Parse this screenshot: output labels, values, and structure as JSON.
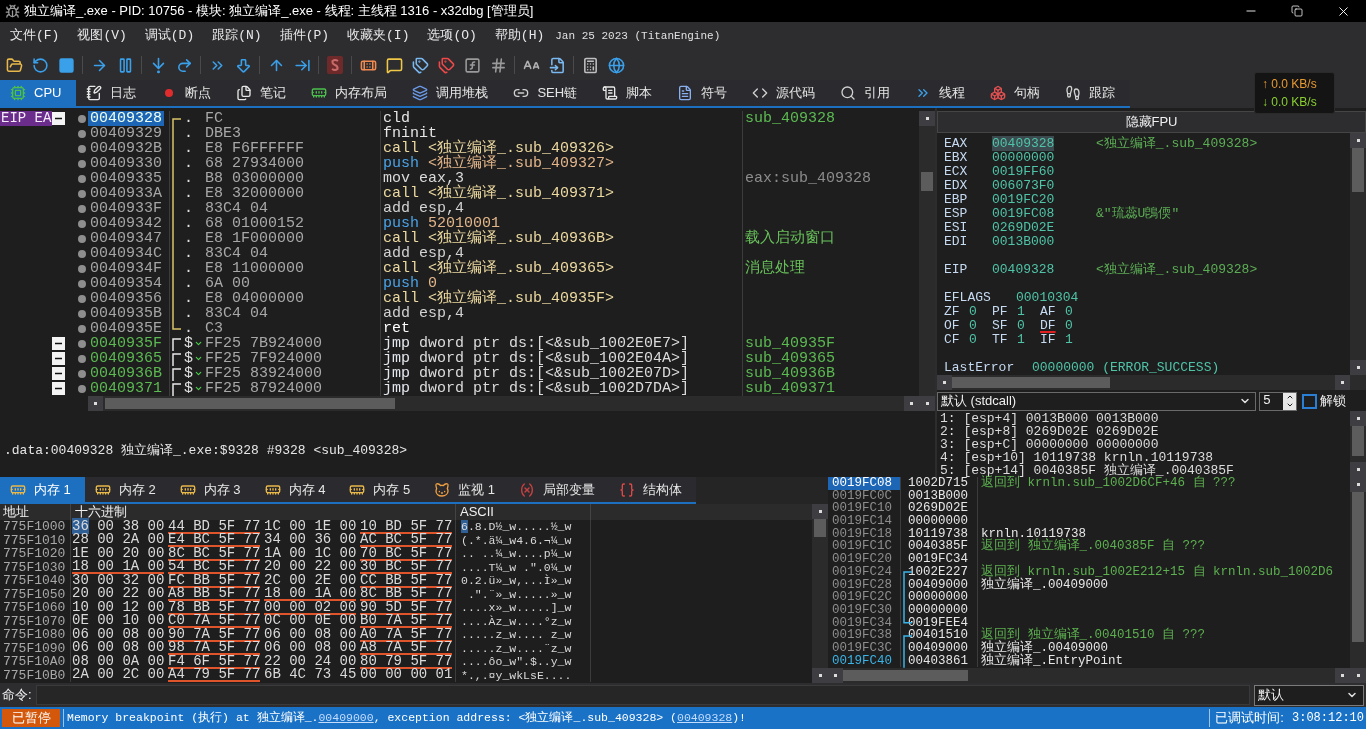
{
  "window": {
    "title": "独立编译_.exe - PID: 10756 - 模块: 独立编译_.exe - 线程: 主线程 1316 - x32dbg [管理员]"
  },
  "menu": [
    "文件(F)",
    "视图(V)",
    "调试(D)",
    "跟踪(N)",
    "插件(P)",
    "收藏夹(I)",
    "选项(O)",
    "帮助(H)"
  ],
  "build_info": "Jan 25 2023 (TitanEngine)",
  "tabs": [
    {
      "label": "CPU",
      "selected": true
    },
    {
      "label": "日志",
      "selected": false
    },
    {
      "label": "断点",
      "selected": false
    },
    {
      "label": "笔记",
      "selected": false
    },
    {
      "label": "内存布局",
      "selected": false
    },
    {
      "label": "调用堆栈",
      "selected": false
    },
    {
      "label": "SEH链",
      "selected": false
    },
    {
      "label": "脚本",
      "selected": false
    },
    {
      "label": "符号",
      "selected": false
    },
    {
      "label": "源代码",
      "selected": false
    },
    {
      "label": "引用",
      "selected": false
    },
    {
      "label": "线程",
      "selected": false
    },
    {
      "label": "句柄",
      "selected": false
    },
    {
      "label": "跟踪",
      "selected": false
    }
  ],
  "net_speed": {
    "upload": "↑ 0.0 KB/s",
    "download": "↓ 0.0 KB/s"
  },
  "disassembly": {
    "blocks": [
      {
        "kind": "function",
        "expanded": true,
        "rows": [
          {
            "gutter_label": "EIP EA",
            "address": "00409328",
            "selected": true,
            "entry": true,
            "marker": ".",
            "jump": false,
            "bytes": "FC",
            "kind": "plain",
            "mnemonic": "cld",
            "comment": {
              "text": "sub_409328",
              "kind": "label"
            }
          },
          {
            "address": "00409329",
            "selected": false,
            "entry": false,
            "marker": ".",
            "jump": false,
            "bytes": "DBE3",
            "kind": "plain",
            "mnemonic": "fninit"
          },
          {
            "address": "0040932B",
            "selected": false,
            "entry": false,
            "marker": ".",
            "jump": false,
            "bytes": "E8 F6FFFFFF",
            "kind": "call",
            "mnemonic": "call",
            "operands": "<独立编译_.sub_409326>"
          },
          {
            "address": "00409330",
            "selected": false,
            "entry": false,
            "marker": ".",
            "jump": false,
            "bytes": "68 27934000",
            "kind": "push",
            "mnemonic": "push",
            "operands": "<独立编译_.sub_409327>"
          },
          {
            "address": "00409335",
            "selected": false,
            "entry": false,
            "marker": ".",
            "jump": false,
            "bytes": "B8 03000000",
            "kind": "mov",
            "mnemonic": "mov",
            "operands": "eax,3",
            "comment": {
              "text": "eax:sub_409328",
              "kind": "auto"
            }
          },
          {
            "address": "0040933A",
            "selected": false,
            "entry": false,
            "marker": ".",
            "jump": false,
            "bytes": "E8 32000000",
            "kind": "call",
            "mnemonic": "call",
            "operands": "<独立编译_.sub_409371>"
          },
          {
            "address": "0040933F",
            "selected": false,
            "entry": false,
            "marker": ".",
            "jump": false,
            "bytes": "83C4 04",
            "kind": "add",
            "mnemonic": "add",
            "operands": "esp,4"
          },
          {
            "address": "00409342",
            "selected": false,
            "entry": false,
            "marker": ".",
            "jump": false,
            "bytes": "68 01000152",
            "kind": "push",
            "mnemonic": "push",
            "operands": "52010001"
          },
          {
            "address": "00409347",
            "selected": false,
            "entry": false,
            "marker": ".",
            "jump": false,
            "bytes": "E8 1F000000",
            "kind": "call",
            "mnemonic": "call",
            "operands": "<独立编译_.sub_40936B>",
            "comment": {
              "text": "载入启动窗口",
              "kind": "user"
            }
          },
          {
            "address": "0040934C",
            "selected": false,
            "entry": false,
            "marker": ".",
            "jump": false,
            "bytes": "83C4 04",
            "kind": "add",
            "mnemonic": "add",
            "operands": "esp,4"
          },
          {
            "address": "0040934F",
            "selected": false,
            "entry": false,
            "marker": ".",
            "jump": false,
            "bytes": "E8 11000000",
            "kind": "call",
            "mnemonic": "call",
            "operands": "<独立编译_.sub_409365>",
            "comment": {
              "text": "消息处理",
              "kind": "user"
            }
          },
          {
            "address": "00409354",
            "selected": false,
            "entry": false,
            "marker": ".",
            "jump": false,
            "bytes": "6A 00",
            "kind": "push",
            "mnemonic": "push",
            "operands": "0"
          },
          {
            "address": "00409356",
            "selected": false,
            "entry": false,
            "marker": ".",
            "jump": false,
            "bytes": "E8 04000000",
            "kind": "call",
            "mnemonic": "call",
            "operands": "<独立编译_.sub_40935F>"
          },
          {
            "address": "0040935B",
            "selected": false,
            "entry": false,
            "marker": ".",
            "jump": false,
            "bytes": "83C4 04",
            "kind": "add",
            "mnemonic": "add",
            "operands": "esp,4"
          },
          {
            "address": "0040935E",
            "selected": false,
            "entry": false,
            "marker": ".",
            "jump": false,
            "bytes": "C3",
            "kind": "ret",
            "mnemonic": "ret"
          }
        ]
      },
      {
        "kind": "thunk",
        "expanded": true,
        "rows": [
          {
            "address": "0040935F",
            "selected": false,
            "entry": true,
            "marker": "$",
            "jump": true,
            "bytes": "FF25 7B924000",
            "kind": "jmp",
            "mnemonic": "jmp",
            "operands": "dword ptr ds:[<&sub_1002E0E7>]",
            "comment": {
              "text": "sub_40935F",
              "kind": "label"
            }
          }
        ]
      },
      {
        "kind": "thunk",
        "expanded": true,
        "rows": [
          {
            "address": "00409365",
            "selected": false,
            "entry": true,
            "marker": "$",
            "jump": true,
            "bytes": "FF25 7F924000",
            "kind": "jmp",
            "mnemonic": "jmp",
            "operands": "dword ptr ds:[<&sub_1002E04A>]",
            "comment": {
              "text": "sub_409365",
              "kind": "label"
            }
          }
        ]
      },
      {
        "kind": "thunk",
        "expanded": true,
        "rows": [
          {
            "address": "0040936B",
            "selected": false,
            "entry": true,
            "marker": "$",
            "jump": true,
            "bytes": "FF25 83924000",
            "kind": "jmp",
            "mnemonic": "jmp",
            "operands": "dword ptr ds:[<&sub_1002E07D>]",
            "comment": {
              "text": "sub_40936B",
              "kind": "label"
            }
          }
        ]
      },
      {
        "kind": "thunk",
        "expanded": true,
        "rows": [
          {
            "address": "00409371",
            "selected": false,
            "entry": true,
            "marker": "$",
            "jump": true,
            "bytes": "FF25 87924000",
            "kind": "jmp",
            "mnemonic": "jmp",
            "operands": "dword ptr ds:[<&sub_1002D7DA>]",
            "comment": {
              "text": "sub_409371",
              "kind": "label"
            }
          }
        ]
      }
    ]
  },
  "registers": {
    "toggle": "隐藏FPU",
    "general": [
      {
        "name": "EAX",
        "value": "00409328",
        "comment": "<独立编译_.sub_409328>",
        "selected": true
      },
      {
        "name": "EBX",
        "value": "00000000",
        "selected": false
      },
      {
        "name": "ECX",
        "value": "0019FF60",
        "selected": false
      },
      {
        "name": "EDX",
        "value": "006073F0",
        "selected": false
      },
      {
        "name": "EBP",
        "value": "0019FC20",
        "selected": false
      },
      {
        "name": "ESP",
        "value": "0019FC08",
        "comment": "&\"琉蕊U鵖偄\"",
        "selected": false
      },
      {
        "name": "ESI",
        "value": "0269D02E",
        "selected": false
      },
      {
        "name": "EDI",
        "value": "0013B000",
        "selected": false
      }
    ],
    "eip": {
      "name": "EIP",
      "value": "00409328",
      "comment": "<独立编译_.sub_409328>"
    },
    "eflags": {
      "name": "EFLAGS",
      "value": "00010304"
    },
    "flags": [
      {
        "name": "ZF",
        "value": "0",
        "highlighted": false
      },
      {
        "name": "PF",
        "value": "1",
        "highlighted": false
      },
      {
        "name": "AF",
        "value": "0",
        "highlighted": false
      },
      {
        "name": "OF",
        "value": "0",
        "highlighted": false
      },
      {
        "name": "SF",
        "value": "0",
        "highlighted": false
      },
      {
        "name": "DF",
        "value": "0",
        "highlighted": true
      },
      {
        "name": "CF",
        "value": "0",
        "highlighted": false
      },
      {
        "name": "TF",
        "value": "1",
        "highlighted": false
      },
      {
        "name": "IF",
        "value": "1",
        "highlighted": false
      }
    ],
    "last_error": {
      "name": "LastError",
      "value": "00000000 (ERROR_SUCCESS)"
    }
  },
  "info_line": ".data:00409328 独立编译_.exe:$9328 #9328 <sub_409328>",
  "call_args": {
    "convention": "默认 (stdcall)",
    "count": "5",
    "lock": {
      "label": "解锁",
      "checked": false
    },
    "rows": [
      "1: [esp+4] 0013B000 0013B000",
      "2: [esp+8] 0269D02E 0269D02E",
      "3: [esp+C] 00000000 00000000",
      "4: [esp+10] 10119738 krnln.10119738",
      "5: [esp+14] 0040385F 独立编译_.0040385F"
    ]
  },
  "memory": {
    "tabs": [
      {
        "label": "内存 1",
        "selected": true
      },
      {
        "label": "内存 2",
        "selected": false
      },
      {
        "label": "内存 3",
        "selected": false
      },
      {
        "label": "内存 4",
        "selected": false
      },
      {
        "label": "内存 5",
        "selected": false
      },
      {
        "label": "监视 1",
        "selected": false
      },
      {
        "label": "局部变量",
        "selected": false
      },
      {
        "label": "结构体",
        "selected": false
      }
    ],
    "columns": [
      "地址",
      "十六进制",
      "ASCII"
    ],
    "rows": [
      {
        "address": "775F1000",
        "cursor": true,
        "groups": [
          {
            "hex": "36 00 38 00",
            "pointer": false
          },
          {
            "hex": "44 BD 5F 77",
            "pointer": true
          },
          {
            "hex": "1C 00 1E 00",
            "pointer": false
          },
          {
            "hex": "10 BD 5F 77",
            "pointer": true
          }
        ],
        "ascii": "6.8.D½_w.....½_w"
      },
      {
        "address": "775F1010",
        "cursor": false,
        "groups": [
          {
            "hex": "28 00 2A 00",
            "pointer": false
          },
          {
            "hex": "E4 BC 5F 77",
            "pointer": true
          },
          {
            "hex": "34 00 36 00",
            "pointer": false
          },
          {
            "hex": "AC BC 5F 77",
            "pointer": true
          }
        ],
        "ascii": "(.*.ä¼_w4.6.¬¼_w"
      },
      {
        "address": "775F1020",
        "cursor": false,
        "groups": [
          {
            "hex": "1E 00 20 00",
            "pointer": false
          },
          {
            "hex": "8C BC 5F 77",
            "pointer": true
          },
          {
            "hex": "1A 00 1C 00",
            "pointer": false
          },
          {
            "hex": "70 BC 5F 77",
            "pointer": true
          }
        ],
        "ascii": ".. ..¼_w....p¼_w"
      },
      {
        "address": "775F1030",
        "cursor": false,
        "groups": [
          {
            "hex": "18 00 1A 00",
            "pointer": true
          },
          {
            "hex": "54 BC 5F 77",
            "pointer": true
          },
          {
            "hex": "20 00 22 00",
            "pointer": false
          },
          {
            "hex": "30 BC 5F 77",
            "pointer": true
          }
        ],
        "ascii": "....T¼_w .\".0¼_w"
      },
      {
        "address": "775F1040",
        "cursor": false,
        "groups": [
          {
            "hex": "30 00 32 00",
            "pointer": false
          },
          {
            "hex": "FC BB 5F 77",
            "pointer": true
          },
          {
            "hex": "2C 00 2E 00",
            "pointer": false
          },
          {
            "hex": "CC BB 5F 77",
            "pointer": true
          }
        ],
        "ascii": "0.2.ü»_w,...Ì»_w"
      },
      {
        "address": "775F1050",
        "cursor": false,
        "groups": [
          {
            "hex": "20 00 22 00",
            "pointer": false
          },
          {
            "hex": "A8 BB 5F 77",
            "pointer": true
          },
          {
            "hex": "18 00 1A 00",
            "pointer": true
          },
          {
            "hex": "8C BB 5F 77",
            "pointer": true
          }
        ],
        "ascii": " .\".¨»_w.....»_w"
      },
      {
        "address": "775F1060",
        "cursor": false,
        "groups": [
          {
            "hex": "10 00 12 00",
            "pointer": false
          },
          {
            "hex": "78 BB 5F 77",
            "pointer": true
          },
          {
            "hex": "00 00 02 00",
            "pointer": true
          },
          {
            "hex": "90 5D 5F 77",
            "pointer": true
          }
        ],
        "ascii": "....x»_w.....]_w"
      },
      {
        "address": "775F1070",
        "cursor": false,
        "groups": [
          {
            "hex": "0E 00 10 00",
            "pointer": false
          },
          {
            "hex": "C0 7A 5F 77",
            "pointer": true
          },
          {
            "hex": "0C 00 0E 00",
            "pointer": false
          },
          {
            "hex": "B0 7A 5F 77",
            "pointer": true
          }
        ],
        "ascii": "....Àz_w....°z_w"
      },
      {
        "address": "775F1080",
        "cursor": false,
        "groups": [
          {
            "hex": "06 00 08 00",
            "pointer": false
          },
          {
            "hex": "90 7A 5F 77",
            "pointer": true
          },
          {
            "hex": "06 00 08 00",
            "pointer": false
          },
          {
            "hex": "A0 7A 5F 77",
            "pointer": true
          }
        ],
        "ascii": ".....z_w.... z_w"
      },
      {
        "address": "775F1090",
        "cursor": false,
        "groups": [
          {
            "hex": "06 00 08 00",
            "pointer": false
          },
          {
            "hex": "98 7A 5F 77",
            "pointer": true
          },
          {
            "hex": "06 00 08 00",
            "pointer": false
          },
          {
            "hex": "A8 7A 5F 77",
            "pointer": true
          }
        ],
        "ascii": ".....z_w....¨z_w"
      },
      {
        "address": "775F10A0",
        "cursor": false,
        "groups": [
          {
            "hex": "08 00 0A 00",
            "pointer": false
          },
          {
            "hex": "F4 6F 5F 77",
            "pointer": true
          },
          {
            "hex": "22 00 24 00",
            "pointer": false
          },
          {
            "hex": "80 79 5F 77",
            "pointer": true
          }
        ],
        "ascii": "....ôo_w\".$..y_w"
      },
      {
        "address": "775F10B0",
        "cursor": false,
        "groups": [
          {
            "hex": "2A 00 2C 00",
            "pointer": false
          },
          {
            "hex": "A4 79 5F 77",
            "pointer": true
          },
          {
            "hex": "6B 4C 73 45",
            "pointer": false
          },
          {
            "hex": "00 00 00 01",
            "pointer": false
          }
        ],
        "ascii": "*.,.¤y_wkLsE...."
      }
    ]
  },
  "stack": {
    "blocks": [
      {
        "kind": "loose",
        "rows": [
          {
            "address": "0019FC08",
            "value": "1002D715",
            "comment": {
              "text": "返回到 krnln.sub_1002D6CF+46 自 ???",
              "kind": "return"
            },
            "selected": true,
            "marked": false
          },
          {
            "address": "0019FC0C",
            "value": "0013B000",
            "selected": false,
            "marked": false
          },
          {
            "address": "0019FC10",
            "value": "0269D02E",
            "selected": false,
            "marked": false
          },
          {
            "address": "0019FC14",
            "value": "00000000",
            "selected": false,
            "marked": false
          },
          {
            "address": "0019FC18",
            "value": "10119738",
            "comment": {
              "text": "krnln.10119738",
              "kind": "plain"
            },
            "selected": false,
            "marked": false
          },
          {
            "address": "0019FC1C",
            "value": "0040385F",
            "comment": {
              "text": "返回到 独立编译_.0040385F 自 ???",
              "kind": "return"
            },
            "selected": false,
            "marked": false
          },
          {
            "address": "0019FC20",
            "value": "0019FC34",
            "selected": false,
            "marked": false
          }
        ]
      },
      {
        "kind": "frame",
        "rows": [
          {
            "address": "0019FC24",
            "value": "1002E227",
            "comment": {
              "text": "返回到 krnln.sub_1002E212+15 自 krnln.sub_1002D6",
              "kind": "return"
            },
            "selected": false,
            "marked": false
          },
          {
            "address": "0019FC28",
            "value": "00409000",
            "comment": {
              "text": "独立编译_.00409000",
              "kind": "plain"
            },
            "selected": false,
            "marked": false
          },
          {
            "address": "0019FC2C",
            "value": "00000000",
            "selected": false,
            "marked": false
          },
          {
            "address": "0019FC30",
            "value": "00000000",
            "selected": false,
            "marked": false
          },
          {
            "address": "0019FC34",
            "value": "0019FEE4",
            "selected": false,
            "marked": false
          }
        ]
      },
      {
        "kind": "partial",
        "rows": [
          {
            "address": "0019FC38",
            "value": "00401510",
            "comment": {
              "text": "返回到 独立编译_.00401510 自 ???",
              "kind": "return"
            },
            "selected": false,
            "marked": false
          },
          {
            "address": "0019FC3C",
            "value": "00409000",
            "comment": {
              "text": "独立编译_.00409000",
              "kind": "plain"
            },
            "selected": false,
            "marked": false
          },
          {
            "address": "0019FC40",
            "value": "00403861",
            "comment": {
              "text": "独立编译_.EntryPoint",
              "kind": "plain"
            },
            "selected": false,
            "marked": true
          }
        ]
      }
    ]
  },
  "command": {
    "label": "命令:",
    "mode": "默认"
  },
  "status_bar": {
    "state": "已暂停",
    "message": [
      {
        "kind": "text",
        "text": "Memory breakpoint (执行) at 独立编译_."
      },
      {
        "kind": "link",
        "text": "00409000"
      },
      {
        "kind": "text",
        "text": ", exception address: <独立编译_.sub_409328> ("
      },
      {
        "kind": "link",
        "text": "00409328"
      },
      {
        "kind": "text",
        "text": ")!"
      }
    ],
    "timer_label": "已调试时间:",
    "timer": "3:08:12:10"
  }
}
